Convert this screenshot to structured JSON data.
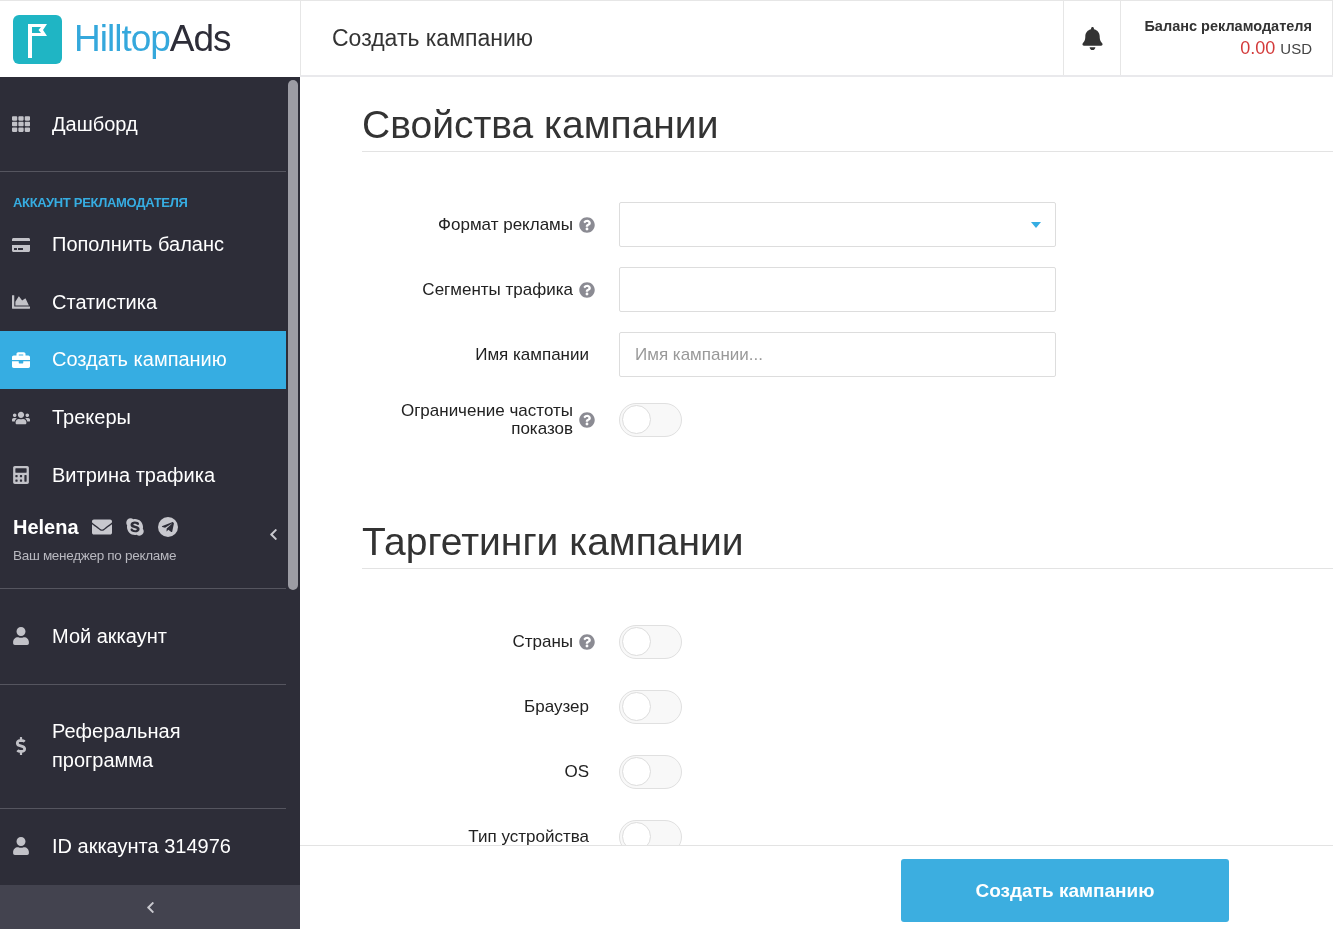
{
  "logo": {
    "part_a": "Hilltop",
    "part_b": "Ads"
  },
  "header": {
    "title": "Создать кампанию",
    "balance_label": "Баланс рекламодателя",
    "balance_amount": "0.00",
    "balance_currency": "USD"
  },
  "sidebar": {
    "top_items": [
      {
        "label": "Дашборд",
        "selected": false
      }
    ],
    "section_heading": "АККАУНТ РЕКЛАМОДАТЕЛЯ",
    "account_items": [
      {
        "label": "Пополнить баланс",
        "selected": false
      },
      {
        "label": "Статистика",
        "selected": false
      },
      {
        "label": "Создать кампанию",
        "selected": true
      },
      {
        "label": "Трекеры",
        "selected": false
      },
      {
        "label": "Витрина трафика",
        "selected": false
      }
    ],
    "manager": {
      "name": "Helena",
      "subtitle": "Ваш менеджер по рекламе"
    },
    "bottom_items": [
      {
        "label": "Мой аккаунт",
        "selected": false
      },
      {
        "label": "Реферальная программа",
        "selected": false
      },
      {
        "label": "ID аккаунта 314976",
        "selected": false
      }
    ]
  },
  "sections": [
    {
      "title": "Свойства кампании",
      "fields": [
        {
          "kind": "select",
          "label": "Формат рекламы",
          "help": true
        },
        {
          "kind": "text",
          "label": "Сегменты трафика",
          "help": true
        },
        {
          "kind": "text",
          "label": "Имя кампании",
          "help": false,
          "placeholder": "Имя кампании..."
        },
        {
          "kind": "toggle",
          "label": "Ограничение частоты показов",
          "help": true,
          "on": false
        }
      ]
    },
    {
      "title": "Таргетинги кампании",
      "fields": [
        {
          "kind": "toggle",
          "label": "Страны",
          "help": true,
          "on": false
        },
        {
          "kind": "toggle",
          "label": "Браузер",
          "help": false,
          "on": false
        },
        {
          "kind": "toggle",
          "label": "OS",
          "help": false,
          "on": false
        },
        {
          "kind": "toggle",
          "label": "Тип устройства",
          "help": false,
          "on": false
        }
      ]
    }
  ],
  "footer": {
    "submit": "Создать кампанию"
  }
}
